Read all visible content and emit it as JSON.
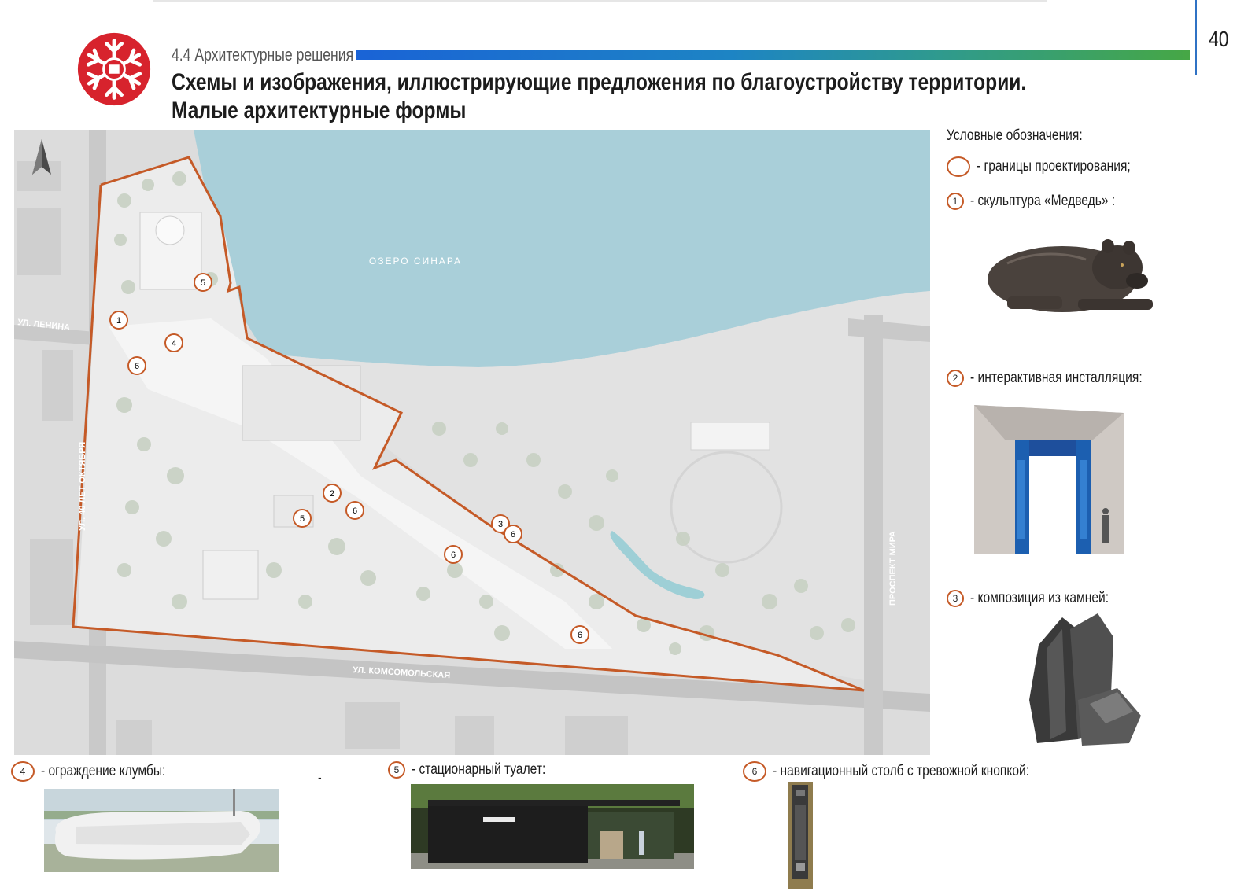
{
  "page": {
    "number": "40",
    "section": "4.4 Архитектурные решения",
    "title_line1": "Схемы и изображения, иллюстрирующие предложения по благоустройству территории.",
    "title_line2": "Малые архитектурные формы"
  },
  "colors": {
    "boundary": "#c55a27",
    "lake": "#a9cfd9",
    "accent_blue": "#1a63d6",
    "accent_green": "#46a745",
    "logo_red": "#d7232d"
  },
  "map": {
    "lake_label": "ОЗЕРО СИНАРА",
    "streets": {
      "lenina": "УЛ. ЛЕНИНА",
      "oktyabrya": "УЛ. 40 ЛЕТ ОКТЯБРЯ",
      "komsomolskaya": "УЛ. КОМСОМОЛЬСКАЯ",
      "mira": "ПРОСПЕКТ МИРА"
    },
    "north_arrow_icon": "north-arrow-icon",
    "markers": [
      "5",
      "1",
      "4",
      "6",
      "2",
      "6",
      "5",
      "3",
      "6",
      "6",
      "6"
    ]
  },
  "legend": {
    "title": "Условные обозначения:",
    "items": [
      {
        "marker": "",
        "label": "- границы проектирования;"
      },
      {
        "marker": "1",
        "label": "- скульптура «Медведь» :"
      },
      {
        "marker": "2",
        "label": "- интерактивная инсталляция:"
      },
      {
        "marker": "3",
        "label": "- композиция из камней:"
      }
    ]
  },
  "bottom": {
    "items": [
      {
        "marker": "4",
        "label": "- ограждение клумбы:"
      },
      {
        "marker": "5",
        "label": "- стационарный туалет:"
      },
      {
        "marker": "6",
        "label": "- навигационный столб с тревожной кнопкой:"
      }
    ],
    "stray_dash": "-"
  }
}
